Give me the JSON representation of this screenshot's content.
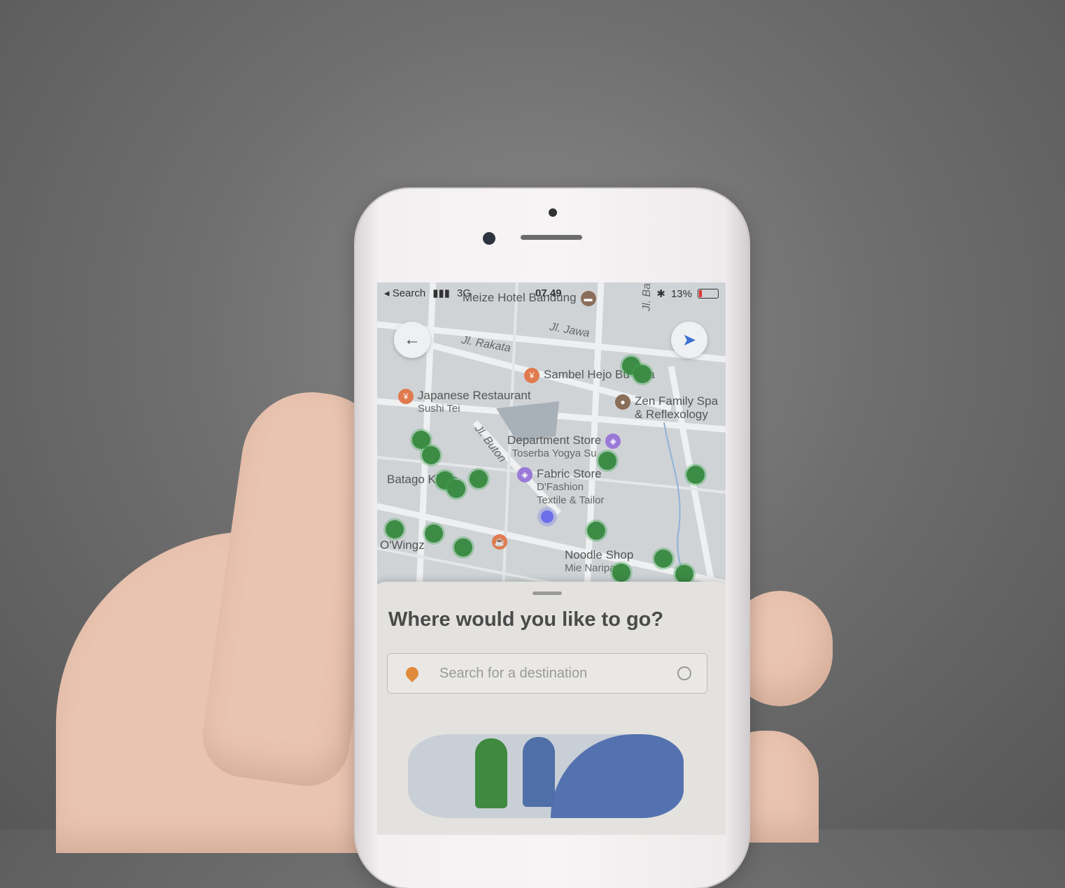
{
  "status_bar": {
    "back_label": "Search",
    "network": "3G",
    "time": "07.49",
    "battery": "13%"
  },
  "map": {
    "streets": [
      "Jl. Jawa",
      "Jl. Rakata",
      "Jl. Buton",
      "Jl. Ba"
    ],
    "pois": [
      {
        "name": "Meize Hotel Bandung",
        "sub": ""
      },
      {
        "name": "Sambel Hejo Bu Una",
        "sub": ""
      },
      {
        "name": "Japanese Restaurant",
        "sub": "Sushi Tei"
      },
      {
        "name": "Zen Family Spa",
        "sub": "& Reflexology"
      },
      {
        "name": "Department Store",
        "sub": "Toserba Yogya Su"
      },
      {
        "name": "Fabric Store",
        "sub": "D'Fashion"
      },
      {
        "name": "Textile & Tailor",
        "sub": ""
      },
      {
        "name": "Batago Kings",
        "sub": ""
      },
      {
        "name": "O'Wingz",
        "sub": ""
      },
      {
        "name": "Noodle Shop",
        "sub": "Mie Naripan"
      }
    ]
  },
  "sheet": {
    "title": "Where would you like to go?",
    "search_placeholder": "Search for a destination"
  }
}
